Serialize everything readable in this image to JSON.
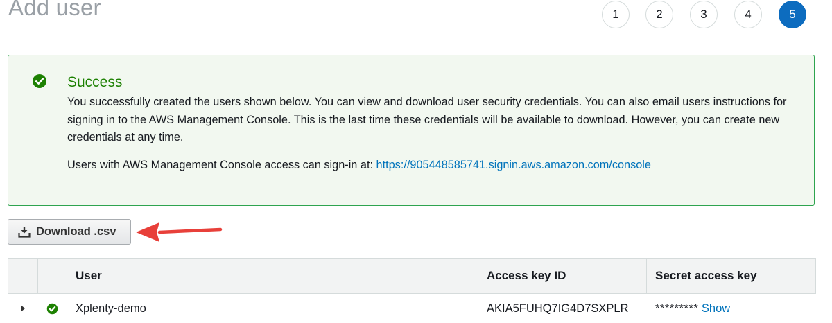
{
  "header": {
    "title": "Add user",
    "steps": [
      "1",
      "2",
      "3",
      "4",
      "5"
    ],
    "active_step": "5"
  },
  "success": {
    "title": "Success",
    "message": "You successfully created the users shown below. You can view and download user security credentials. You can also email users instructions for signing in to the AWS Management Console. This is the last time these credentials will be available to download. However, you can create new credentials at any time.",
    "console_prefix": "Users with AWS Management Console access can sign-in at: ",
    "console_url": "https://905448585741.signin.aws.amazon.com/console"
  },
  "toolbar": {
    "download_label": "Download .csv"
  },
  "table": {
    "columns": [
      "User",
      "Access key ID",
      "Secret access key"
    ],
    "rows": [
      {
        "user": "Xplenty-demo",
        "access_key_id": "AKIA5FUHQ7IG4D7SXPLR",
        "secret_mask": "*********",
        "show_label": "Show"
      }
    ]
  },
  "colors": {
    "success_green": "#1d8102",
    "active_step_blue": "#0d6cbf",
    "link_blue": "#0073bb",
    "annotation_red": "#e8403a"
  },
  "icons": {
    "success": "check-circle-icon",
    "download": "download-icon",
    "annotation": "red-arrow-icon"
  }
}
